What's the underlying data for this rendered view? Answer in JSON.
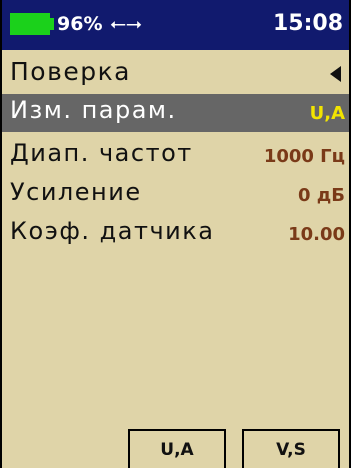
{
  "status": {
    "battery_percent": "96%",
    "battery_level": 0.96,
    "battery_color": "#1bd11b",
    "usb_icon": "usb-icon",
    "time": "15:08"
  },
  "screen": {
    "title": "Поверка",
    "back_icon": "left-triangle-icon",
    "rows": [
      {
        "label": "Изм. парам.",
        "value": "U,A",
        "selected": true
      },
      {
        "label": "Диап. частот",
        "value": "1000 Гц"
      },
      {
        "label": "Усиление",
        "value": "0 дБ"
      },
      {
        "label": "Коэф. датчика",
        "value": "10.00"
      }
    ]
  },
  "softkeys": [
    {
      "label": "U,A"
    },
    {
      "label": "V,S"
    }
  ],
  "colors": {
    "background": "#dfd4a8",
    "statusbar": "#111a6e",
    "selected_row": "#666666",
    "selected_value": "#f2e400",
    "value": "#7a3a18"
  }
}
